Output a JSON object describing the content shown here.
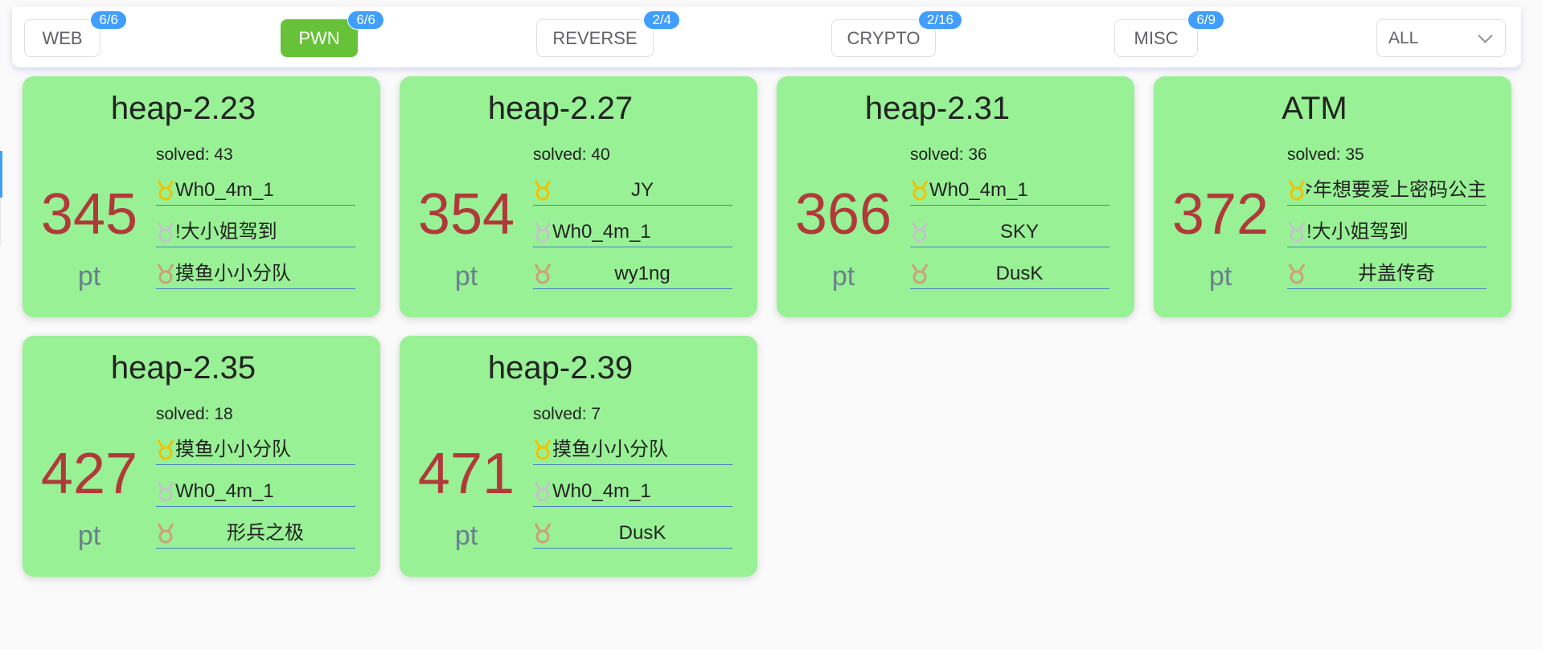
{
  "categories": [
    {
      "label": "WEB",
      "badge": "6/6",
      "active": false
    },
    {
      "label": "PWN",
      "badge": "6/6",
      "active": true
    },
    {
      "label": "REVERSE",
      "badge": "2/4",
      "active": false
    },
    {
      "label": "CRYPTO",
      "badge": "2/16",
      "active": false
    },
    {
      "label": "MISC",
      "badge": "6/9",
      "active": false
    }
  ],
  "filter": {
    "value": "ALL"
  },
  "colors": {
    "card_bg": "#98f195",
    "active_tab": "#67c23a",
    "badge": "#409eff",
    "score": "#b03a3a",
    "gold": "#f2c200",
    "silver": "#c3c3c8",
    "bronze": "#cf9f7a"
  },
  "challenges": [
    {
      "title": "heap-2.23",
      "solved": "solved: 43",
      "score": "345",
      "unit": "pt",
      "solvers": [
        "Wh0_4m_1",
        "大小姐驾到!",
        "摸鱼小小分队"
      ]
    },
    {
      "title": "heap-2.27",
      "solved": "solved: 40",
      "score": "354",
      "unit": "pt",
      "solvers": [
        "JY",
        "Wh0_4m_1",
        "wy1ng"
      ]
    },
    {
      "title": "heap-2.31",
      "solved": "solved: 36",
      "score": "366",
      "unit": "pt",
      "solvers": [
        "Wh0_4m_1",
        "SKY",
        "DusK"
      ]
    },
    {
      "title": "ATM",
      "solved": "solved: 35",
      "score": "372",
      "unit": "pt",
      "solvers": [
        "今年想要爱上密码公主",
        "大小姐驾到!",
        "井盖传奇"
      ]
    },
    {
      "title": "heap-2.35",
      "solved": "solved: 18",
      "score": "427",
      "unit": "pt",
      "solvers": [
        "摸鱼小小分队",
        "Wh0_4m_1",
        "形兵之极"
      ]
    },
    {
      "title": "heap-2.39",
      "solved": "solved: 7",
      "score": "471",
      "unit": "pt",
      "solvers": [
        "摸鱼小小分队",
        "Wh0_4m_1",
        "DusK"
      ]
    }
  ]
}
